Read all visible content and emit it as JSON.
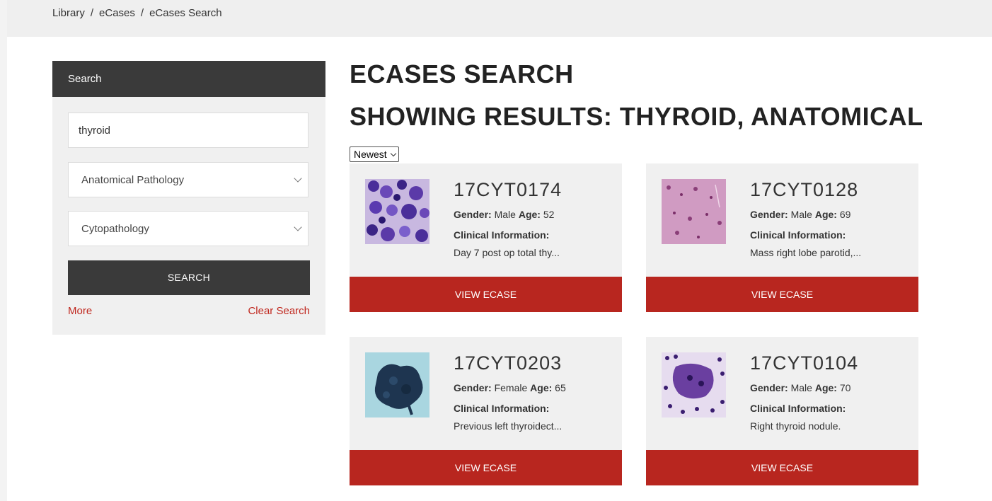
{
  "breadcrumb": [
    "Library",
    "eCases",
    "eCases Search"
  ],
  "sidebar": {
    "header": "Search",
    "query": "thyroid",
    "category": "Anatomical Pathology",
    "subcategory": "Cytopathology",
    "search_label": "SEARCH",
    "more_label": "More",
    "clear_label": "Clear Search"
  },
  "main": {
    "title": "ECASES SEARCH",
    "subtitle": "SHOWING RESULTS: THYROID, ANATOMICAL",
    "sort": "Newest"
  },
  "labels": {
    "gender": "Gender:",
    "age": "Age:",
    "clinical": "Clinical Information:",
    "view": "VIEW ECASE"
  },
  "cases": [
    {
      "id": "17CYT0174",
      "gender": "Male",
      "age": "52",
      "clinical": "Day 7 post op total thy..."
    },
    {
      "id": "17CYT0128",
      "gender": "Male",
      "age": "69",
      "clinical": "Mass right lobe parotid,..."
    },
    {
      "id": "17CYT0203",
      "gender": "Female",
      "age": "65",
      "clinical": "Previous left thyroidect..."
    },
    {
      "id": "17CYT0104",
      "gender": "Male",
      "age": "70",
      "clinical": "Right thyroid nodule."
    }
  ],
  "colors": {
    "accent": "#b8261f",
    "dark": "#3a3a3a",
    "panel": "#f0f0f0"
  }
}
